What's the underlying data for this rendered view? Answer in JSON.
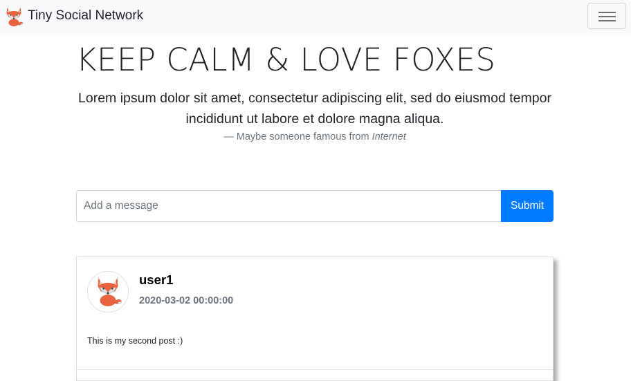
{
  "navbar": {
    "brand_text": "Tiny Social Network",
    "brand_icon": "fox-logo-icon",
    "toggler_icon": "hamburger-menu-icon"
  },
  "hero": {
    "title": "KEEP CALM & LOVE FOXES",
    "quote": "Lorem ipsum dolor sit amet, consectetur adipiscing elit, sed do eiusmod tempor incididunt ut labore et dolore magna aliqua.",
    "attribution_prefix": "— Maybe someone famous from ",
    "attribution_source": "Internet"
  },
  "form": {
    "placeholder": "Add a message",
    "value": "",
    "submit_label": "Submit",
    "accent_color": "#007bff"
  },
  "posts": [
    {
      "avatar_icon": "fox-avatar-icon",
      "username": "user1",
      "date": "2020-03-02 00:00:00",
      "body": "This is my second post :)"
    }
  ]
}
